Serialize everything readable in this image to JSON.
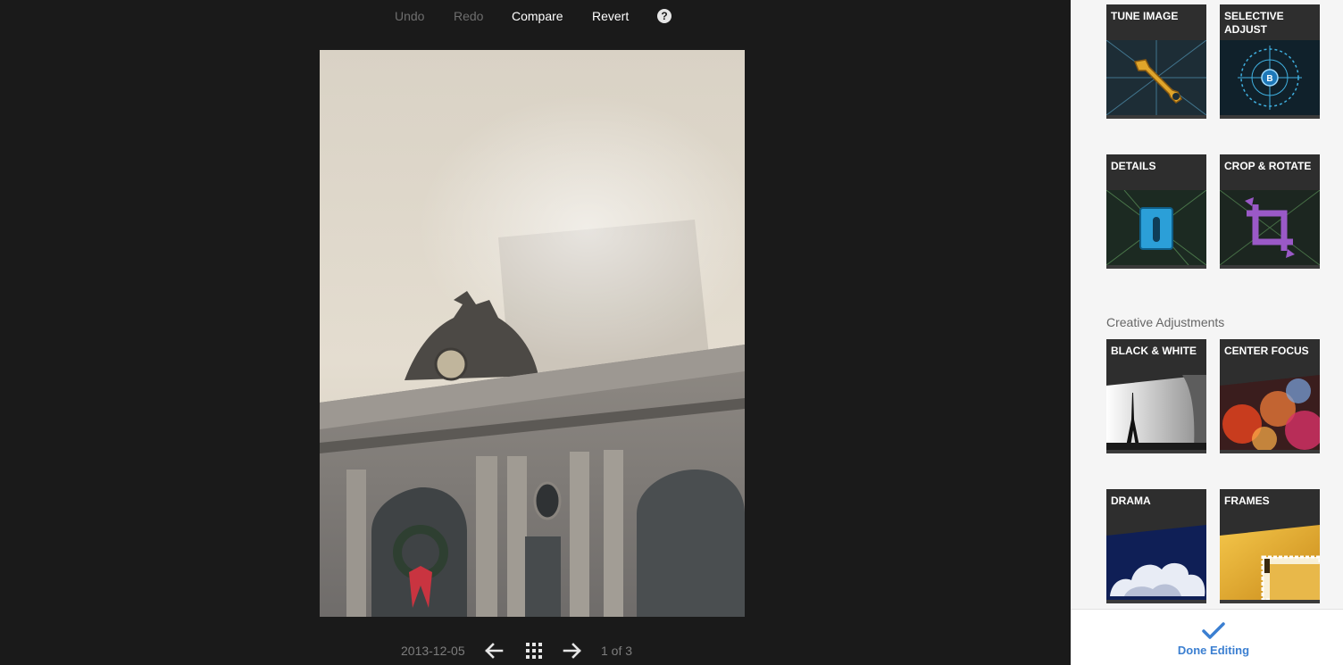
{
  "toolbar": {
    "undo_label": "Undo",
    "redo_label": "Redo",
    "compare_label": "Compare",
    "revert_label": "Revert",
    "help_label": "?"
  },
  "photo": {
    "description_icon": "photo-image"
  },
  "navigation": {
    "date": "2013-12-05",
    "position": "1 of 3",
    "prev_icon": "arrow-left-icon",
    "grid_icon": "grid-icon",
    "next_icon": "arrow-right-icon"
  },
  "panel": {
    "tools": [
      {
        "label": "Tune Image"
      },
      {
        "label": "Selective Adjust"
      },
      {
        "label": "Details"
      },
      {
        "label": "Crop & Rotate"
      }
    ],
    "creative_title": "Creative Adjustments",
    "creative": [
      {
        "label": "Black & White"
      },
      {
        "label": "Center Focus"
      },
      {
        "label": "Drama"
      },
      {
        "label": "Frames"
      }
    ],
    "done_label": "Done Editing"
  },
  "colors": {
    "viewer_bg": "#1a1a1a",
    "panel_bg": "#f5f5f5",
    "accent": "#3b7fd1"
  }
}
